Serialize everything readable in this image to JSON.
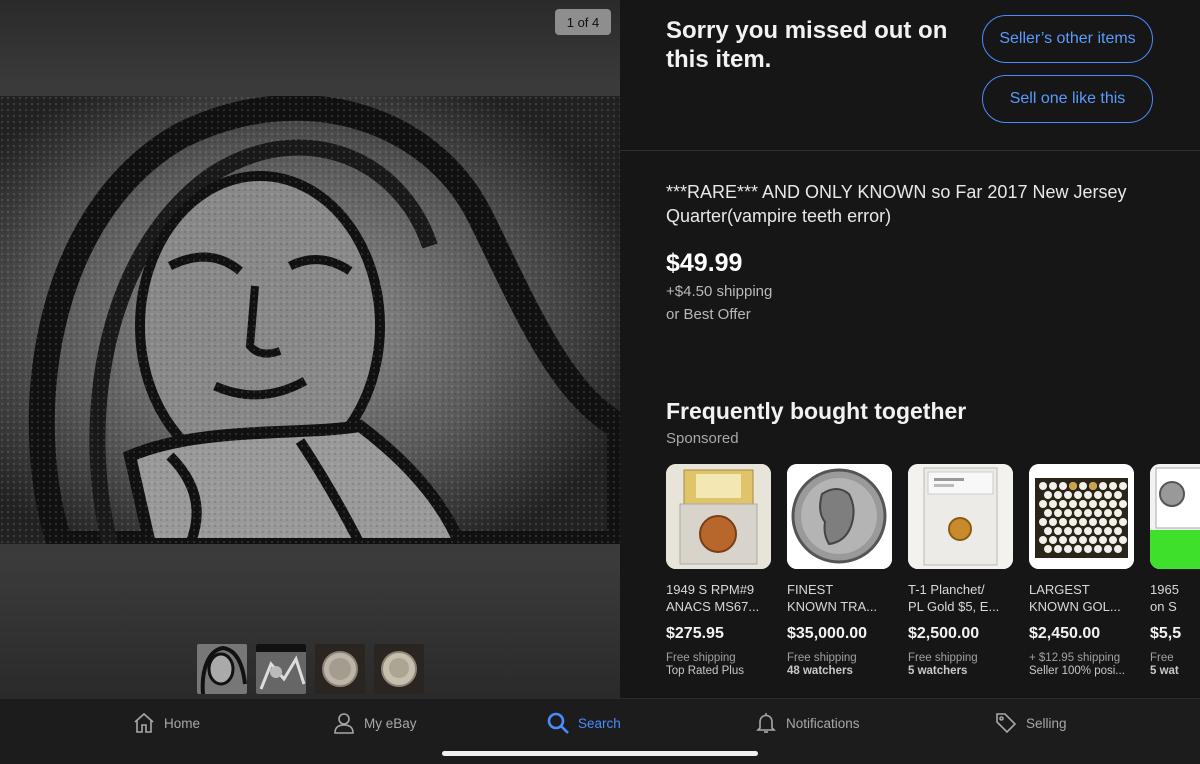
{
  "gallery": {
    "counter": "1 of 4",
    "thumbnail_count": 4
  },
  "status": {
    "headline": "Sorry you missed out on this item.",
    "sellers_other_items": "Seller’s other items",
    "sell_one_like_this": "Sell one like this"
  },
  "item": {
    "title": "***RARE*** AND ONLY KNOWN so Far 2017 New Jersey Quarter(vampire teeth error)",
    "price": "$49.99",
    "shipping": "+$4.50 shipping",
    "best_offer": "or Best Offer"
  },
  "related": {
    "heading": "Frequently bought together",
    "sponsored": "Sponsored",
    "items": [
      {
        "title": "1949 S RPM#9\nANACS MS67...",
        "price": "$275.95",
        "shipping": "Free shipping",
        "meta": "Top Rated Plus",
        "meta_bold": false
      },
      {
        "title": "FINEST\nKNOWN TRA...",
        "price": "$35,000.00",
        "shipping": "Free shipping",
        "meta": "48 watchers",
        "meta_bold": true
      },
      {
        "title": "T-1 Planchet/\nPL Gold $5, E...",
        "price": "$2,500.00",
        "shipping": "Free shipping",
        "meta": "5 watchers",
        "meta_bold": true
      },
      {
        "title": "LARGEST\nKNOWN GOL...",
        "price": "$2,450.00",
        "shipping": "+ $12.95 shipping",
        "meta": "Seller 100% posi...",
        "meta_bold": false
      },
      {
        "title": "1965\non S",
        "price": "$5,5",
        "shipping": "Free",
        "meta": "5 wat",
        "meta_bold": true
      }
    ]
  },
  "tabbar": {
    "home": "Home",
    "my_ebay": "My eBay",
    "search": "Search",
    "notifications": "Notifications",
    "selling": "Selling",
    "active_color": "#4a8cff"
  }
}
